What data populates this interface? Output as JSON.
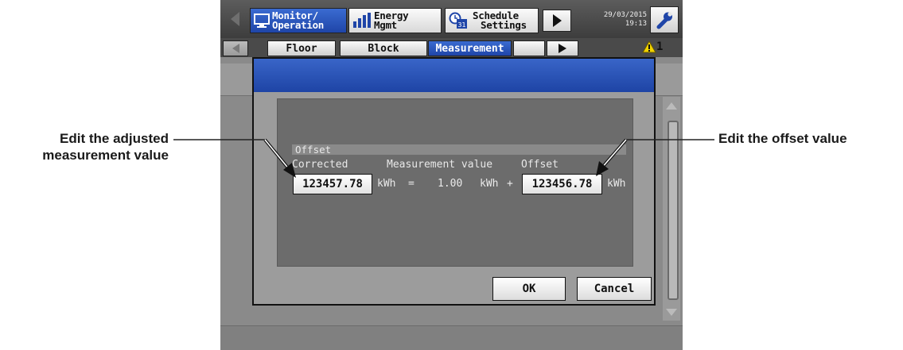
{
  "callouts": {
    "left_line1": "Edit the adjusted",
    "left_line2": "measurement value",
    "right": "Edit the offset value"
  },
  "topbar": {
    "monitor_line1": "Monitor/",
    "monitor_line2": "Operation",
    "energy_line1": "Energy",
    "energy_line2": "Mgmt",
    "schedule_line1": "Schedule",
    "schedule_line2": "Settings",
    "date": "29/03/2015",
    "time": "19:13"
  },
  "tabs": {
    "floor": "Floor",
    "block": "Block",
    "measurement": "Measurement"
  },
  "alarm": {
    "count": "1"
  },
  "dialog": {
    "section_header": "Offset",
    "corrected_label": "Corrected",
    "measurement_label": "Measurement value",
    "offset_label": "Offset",
    "corrected_value": "123457.78",
    "measurement_value": "1.00",
    "offset_value": "123456.78",
    "unit": "kWh",
    "equals": "=",
    "plus": "+",
    "ok_label": "OK",
    "cancel_label": "Cancel"
  },
  "colors": {
    "active_blue": "#2a56bd",
    "panel_gray": "#6c6c6c",
    "alarm_yellow": "#f2d400"
  }
}
